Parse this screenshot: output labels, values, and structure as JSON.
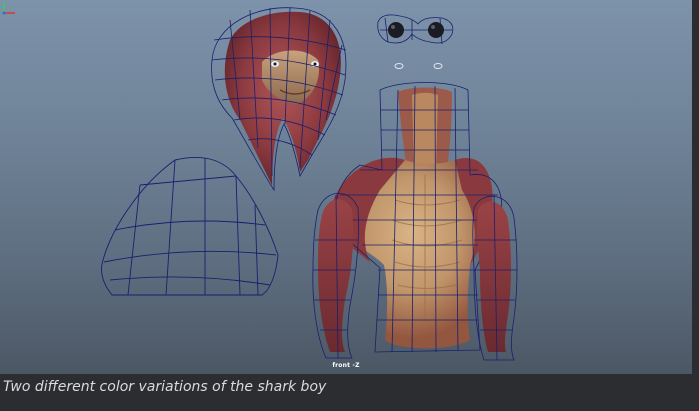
{
  "viewport": {
    "camera_label": "front -Z",
    "wire_color": "#1a1f6e",
    "skin_color": "#8a3a3e",
    "belly_color": "#c8a171"
  },
  "caption": {
    "text": "Two different color variations of the shark boy"
  }
}
